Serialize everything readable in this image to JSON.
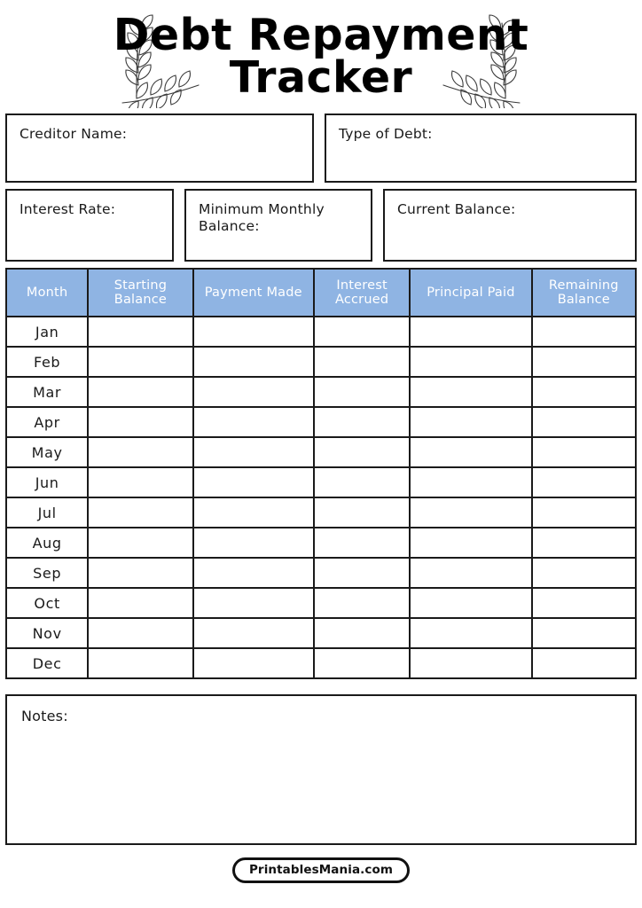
{
  "header": {
    "title_line1": "Debt Repayment",
    "title_line2": "Tracker",
    "decoration_left": "laurel-branch-left",
    "decoration_right": "laurel-branch-right"
  },
  "fields": {
    "creditor_name": {
      "label": "Creditor Name:",
      "value": ""
    },
    "type_of_debt": {
      "label": "Type of Debt:",
      "value": ""
    },
    "interest_rate": {
      "label": "Interest Rate:",
      "value": ""
    },
    "minimum_monthly_balance": {
      "label": "Minimum Monthly Balance:",
      "value": ""
    },
    "current_balance": {
      "label": "Current Balance:",
      "value": ""
    }
  },
  "table": {
    "columns": [
      "Month",
      "Starting Balance",
      "Payment Made",
      "Interest Accrued",
      "Principal Paid",
      "Remaining Balance"
    ],
    "rows": [
      {
        "month": "Jan",
        "starting_balance": "",
        "payment_made": "",
        "interest_accrued": "",
        "principal_paid": "",
        "remaining_balance": ""
      },
      {
        "month": "Feb",
        "starting_balance": "",
        "payment_made": "",
        "interest_accrued": "",
        "principal_paid": "",
        "remaining_balance": ""
      },
      {
        "month": "Mar",
        "starting_balance": "",
        "payment_made": "",
        "interest_accrued": "",
        "principal_paid": "",
        "remaining_balance": ""
      },
      {
        "month": "Apr",
        "starting_balance": "",
        "payment_made": "",
        "interest_accrued": "",
        "principal_paid": "",
        "remaining_balance": ""
      },
      {
        "month": "May",
        "starting_balance": "",
        "payment_made": "",
        "interest_accrued": "",
        "principal_paid": "",
        "remaining_balance": ""
      },
      {
        "month": "Jun",
        "starting_balance": "",
        "payment_made": "",
        "interest_accrued": "",
        "principal_paid": "",
        "remaining_balance": ""
      },
      {
        "month": "Jul",
        "starting_balance": "",
        "payment_made": "",
        "interest_accrued": "",
        "principal_paid": "",
        "remaining_balance": ""
      },
      {
        "month": "Aug",
        "starting_balance": "",
        "payment_made": "",
        "interest_accrued": "",
        "principal_paid": "",
        "remaining_balance": ""
      },
      {
        "month": "Sep",
        "starting_balance": "",
        "payment_made": "",
        "interest_accrued": "",
        "principal_paid": "",
        "remaining_balance": ""
      },
      {
        "month": "Oct",
        "starting_balance": "",
        "payment_made": "",
        "interest_accrued": "",
        "principal_paid": "",
        "remaining_balance": ""
      },
      {
        "month": "Nov",
        "starting_balance": "",
        "payment_made": "",
        "interest_accrued": "",
        "principal_paid": "",
        "remaining_balance": ""
      },
      {
        "month": "Dec",
        "starting_balance": "",
        "payment_made": "",
        "interest_accrued": "",
        "principal_paid": "",
        "remaining_balance": ""
      }
    ]
  },
  "notes": {
    "label": "Notes:",
    "value": ""
  },
  "footer": {
    "brand": "PrintablesMania.com"
  },
  "colors": {
    "header_blue": "#8fb4e3",
    "header_text": "#ffffff",
    "ink": "#1a1a1a",
    "page_background": "#ffffff"
  }
}
